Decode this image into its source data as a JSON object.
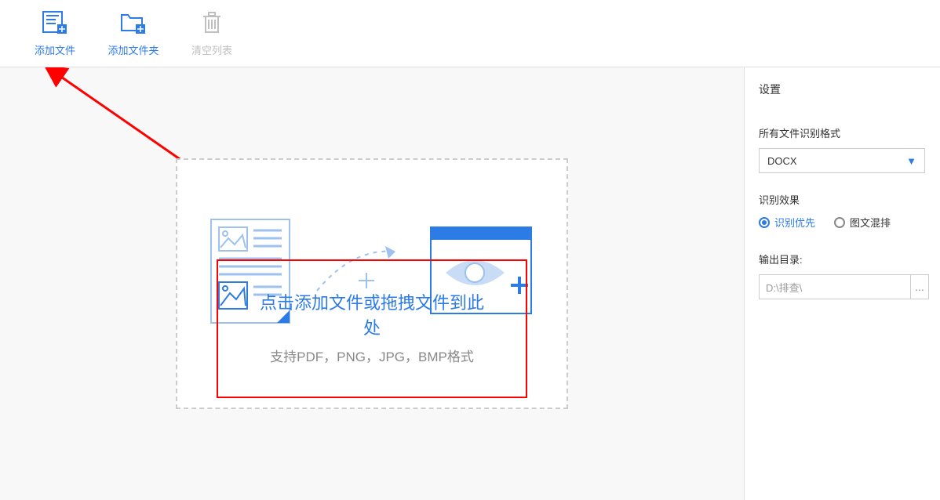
{
  "toolbar": {
    "add_file": "添加文件",
    "add_folder": "添加文件夹",
    "clear_list": "清空列表"
  },
  "dropzone": {
    "title": "点击添加文件或拖拽文件到此处",
    "subtitle": "支持PDF，PNG，JPG，BMP格式"
  },
  "sidebar": {
    "title": "设置",
    "format_label": "所有文件识别格式",
    "format_value": "DOCX",
    "effect_label": "识别效果",
    "radio1": "识别优先",
    "radio2": "图文混排",
    "output_label": "输出目录:",
    "output_path": "D:\\排查\\",
    "browse_label": "..."
  }
}
